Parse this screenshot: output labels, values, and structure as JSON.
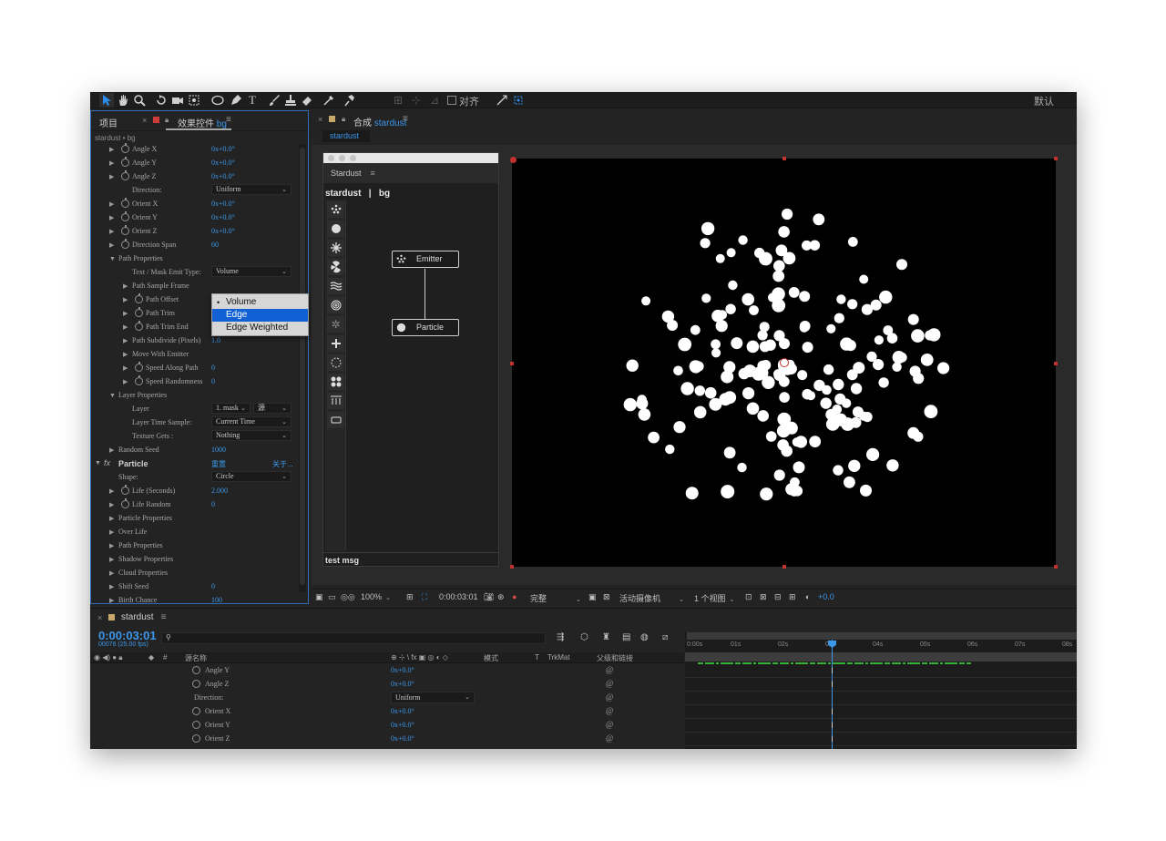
{
  "toolbar": {
    "align_label": "对齐",
    "workspace_label": "默认",
    "tools": [
      "selection-tool",
      "hand-tool",
      "zoom-tool",
      "rotate-tool",
      "camera-tool",
      "pan-behind-tool",
      "ellipse-tool",
      "pen-tool",
      "type-tool",
      "brush-tool",
      "clone-stamp-tool",
      "eraser-tool",
      "roto-brush-tool",
      "puppet-pin-tool"
    ]
  },
  "left_panel": {
    "tab_project": "项目",
    "tab_effects": "效果控件",
    "tab_effects_layer": "bg",
    "subtitle": "stardust • bg",
    "rows": [
      {
        "label": "Angle X",
        "value": "0x+0.0°"
      },
      {
        "label": "Angle Y",
        "value": "0x+0.0°"
      },
      {
        "label": "Angle Z",
        "value": "0x+0.0°"
      },
      {
        "label": "Direction:",
        "dropdown": "Uniform"
      },
      {
        "label": "Orient X",
        "value": "0x+0.0°"
      },
      {
        "label": "Orient Y",
        "value": "0x+0.0°"
      },
      {
        "label": "Orient Z",
        "value": "0x+0.0°"
      },
      {
        "label": "Direction Span",
        "value": "60"
      },
      {
        "label": "Path Properties"
      },
      {
        "label": "Text / Mask Emit Type:",
        "dropdown": "Volume"
      },
      {
        "label": "Path Sample Frame"
      },
      {
        "label": "Path Offset"
      },
      {
        "label": "Path Trim"
      },
      {
        "label": "Path Trim End",
        "value": "0"
      },
      {
        "label": "Path Subdivide (Pixels)",
        "value": "1.0"
      },
      {
        "label": "Move With Emitter"
      },
      {
        "label": "Speed Along Path",
        "value": "0"
      },
      {
        "label": "Speed Randomness",
        "value": "0"
      },
      {
        "label": "Layer Properties"
      },
      {
        "label": "Layer",
        "dropdown": "1. mask",
        "dropdown2": "源"
      },
      {
        "label": "Layer Time Sample:",
        "dropdown": "Current Time"
      },
      {
        "label": "Texture Gets :",
        "dropdown": "Nothing"
      },
      {
        "label": "Random Seed",
        "value": "1000"
      },
      {
        "label": "Particle",
        "reset": "重置",
        "about": "关于..."
      },
      {
        "label": "Shape:",
        "dropdown": "Circle"
      },
      {
        "label": "Life (Seconds)",
        "value": "2.000"
      },
      {
        "label": "Life Random",
        "value": "0"
      },
      {
        "label": "Particle Properties"
      },
      {
        "label": "Over Life"
      },
      {
        "label": "Path Properties"
      },
      {
        "label": "Shadow Properties"
      },
      {
        "label": "Cloud Properties"
      },
      {
        "label": "Shift Seed",
        "value": "0"
      },
      {
        "label": "Birth Chance",
        "value": "100"
      }
    ],
    "popup_options": [
      "Volume",
      "Edge",
      "Edge Weighted"
    ],
    "popup_selected": "Edge"
  },
  "comp": {
    "tab_prefix": "合成",
    "tab_name": "stardust",
    "sub_tab": "stardust"
  },
  "stardust_panel": {
    "title": "Stardust",
    "breadcrumb": "stardust   |   bg",
    "node_emitter": "Emitter",
    "node_particle": "Particle",
    "status": "test msg"
  },
  "viewer_bar": {
    "zoom": "100%",
    "timecode": "0:00:03:01",
    "quality": "完整",
    "camera": "活动摄像机",
    "views": "1 个视图",
    "exposure": "+0.0"
  },
  "timeline": {
    "tab_name": "stardust",
    "time": "0:00:03:01",
    "fps": "00076 (25.00 fps)",
    "search_placeholder": "",
    "headers": {
      "source_name": "源名称",
      "mode": "模式",
      "t": "T",
      "trkmat": "TrkMat",
      "parent": "父级和链接",
      "num": "#"
    },
    "ruler_labels": [
      "0:00s",
      "01s",
      "02s",
      "03s",
      "04s",
      "05s",
      "06s",
      "07s",
      "08s"
    ],
    "rows": [
      {
        "label": "Angle Y",
        "value": "0x+0.0°"
      },
      {
        "label": "Angle Z",
        "value": "0x+0.0°"
      },
      {
        "label": "Direction:",
        "dropdown": "Uniform"
      },
      {
        "label": "Orient X",
        "value": "0x+0.0°"
      },
      {
        "label": "Orient Y",
        "value": "0x+0.0°"
      },
      {
        "label": "Orient Z",
        "value": "0x+0.0°"
      }
    ]
  },
  "colors": {
    "accent_blue": "#3b97ea",
    "handle_red": "#c2312b",
    "panel_bg": "#232323"
  }
}
